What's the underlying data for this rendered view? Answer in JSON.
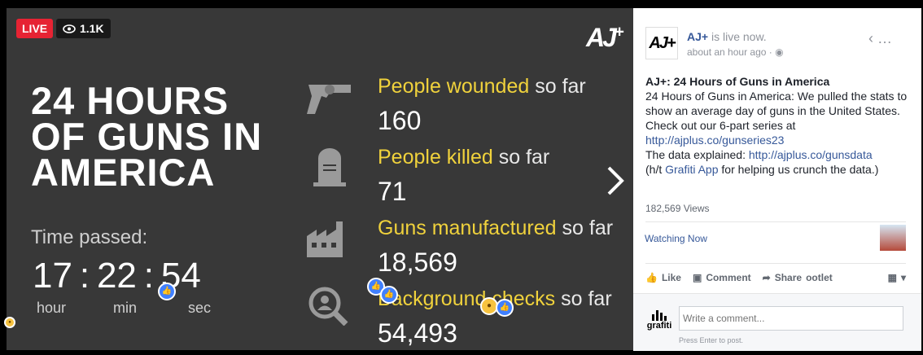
{
  "video": {
    "live_label": "LIVE",
    "viewers": "1.1K",
    "logo_text": "AJ+",
    "title_lines": [
      "24 HOURS",
      "OF GUNS IN",
      "AMERICA"
    ],
    "time_label": "Time passed:",
    "clock": {
      "hours": "17",
      "minutes": "22",
      "seconds": "54",
      "sep": ":"
    },
    "units": {
      "hour": "hour",
      "min": "min",
      "sec": "sec"
    },
    "stats": [
      {
        "label": "People wounded",
        "suffix": "so far",
        "value": "160",
        "icon": "revolver-icon"
      },
      {
        "label": "People killed",
        "suffix": "so far",
        "value": "71",
        "icon": "tombstone-icon"
      },
      {
        "label": "Guns manufactured",
        "suffix": "so far",
        "value": "18,569",
        "icon": "factory-icon"
      },
      {
        "label": "Background checks",
        "suffix": "so far",
        "value": "54,493",
        "icon": "magnifier-person-icon"
      }
    ],
    "colors": {
      "background": "#383838",
      "accent": "#f0d23c",
      "live": "#e62333"
    }
  },
  "panel": {
    "page_name": "AJ+",
    "status": "is live now.",
    "time": "about an hour ago",
    "post_title": "AJ+: 24 Hours of Guns in America",
    "post_body": "24 Hours of Guns in America: We pulled the stats to show an average day of guns in the United States.",
    "check_out": "Check out our 6-part series at",
    "series_link": "http://ajplus.co/gunseries23",
    "data_explained": "The data explained:",
    "data_link": "http://ajplus.co/gunsdata",
    "ht_prefix": "(h/t",
    "ht_link": "Grafiti App",
    "ht_suffix": "for helping us crunch the data.)",
    "views": "182,569 Views",
    "watching_now": "Watching Now",
    "actions": {
      "like": "Like",
      "comment": "Comment",
      "share": "Share",
      "extra": "ootlet"
    },
    "grafiti_label": "grafiti",
    "comment_placeholder": "Write a comment...",
    "enter_hint": "Press Enter to post."
  }
}
